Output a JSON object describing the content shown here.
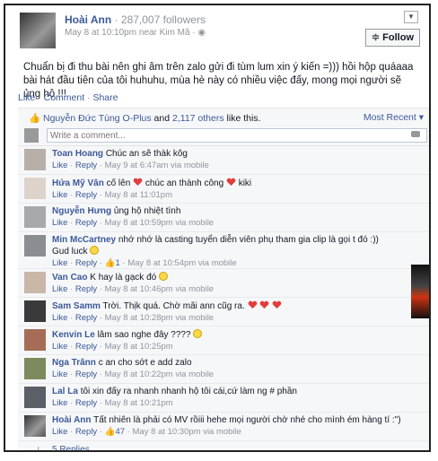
{
  "post": {
    "author": "Hoài Ann",
    "followers": "· 287,007 followers",
    "time": "May 8 at 10:10pm near Kim Mã ·",
    "follow_label": "Follow",
    "text": "Chuẩn bị đi thu bài nên ghi âm trên zalo gửi đi tùm lum xin ý kiến =))) hồi hộp quáaaa bài hát đầu tiên của tôi huhuhu, mùa hè này có nhiều việc đấy, mong mọi người sẽ ủng hộ !!!"
  },
  "actions": {
    "like": "Like",
    "comment": "Comment",
    "share": "Share",
    "sep": "·"
  },
  "likes": {
    "names": "Nguyễn Đức Tùng O-Plus",
    "and": " and ",
    "others": "2,117 others",
    "suffix": " like this.",
    "sort": "Most Recent ▾"
  },
  "write_placeholder": "Write a comment...",
  "comments": [
    {
      "name": "Toan Hoang",
      "text": "Chúc an sẽ thàk kôg",
      "meta": "May 9 at 6:47am via mobile"
    },
    {
      "name": "Hứa Mỹ Vân",
      "text_a": "cố lên",
      "text_b": "chúc an thành công",
      "text_c": "kiki",
      "meta": "May 8 at 11:01pm"
    },
    {
      "name": "Nguyễn Hưng",
      "text": "ủng hộ nhiệt tình",
      "meta": "May 8 at 10:59pm via mobile"
    },
    {
      "name": "Min McCartney",
      "text": "nhớ nhớ là casting tuyển diễn viên phụ tham gia clip là gọi t đó :))",
      "text2": "Gud luck",
      "likes": "1",
      "meta": "May 8 at 10:54pm via mobile"
    },
    {
      "name": "Van Cao",
      "text": "K hay là gạck đó",
      "meta": "May 8 at 10:46pm via mobile"
    },
    {
      "name": "Sam Samm",
      "text": "Trời. Thịk quá. Chờ mãi ann cũg ra.",
      "meta": "May 8 at 10:28pm via mobile"
    },
    {
      "name": "Kenvin Le",
      "text": "lâm sao nghe đây ????",
      "meta": "May 8 at 10:25pm"
    },
    {
      "name": "Nga Trânn",
      "text": "c an cho sớt e add zalo",
      "meta": "May 8 at 10:22pm via mobile"
    },
    {
      "name": "Lal La",
      "text": "tôi xin đấy ra nhanh nhanh hộ tôi cái,cứ làm ng # phần",
      "meta": "May 8 at 10:21pm"
    },
    {
      "name": "Hoài Ann",
      "text": "Tất nhiên là phải có MV rồiii hehe mọi người chờ nhé cho mình ém hàng tí :\")",
      "likes": "47",
      "meta": "May 8 at 10:30pm via mobile"
    }
  ],
  "comment_actions": {
    "like": "Like",
    "reply": "Reply"
  },
  "replies_label": "5 Replies"
}
